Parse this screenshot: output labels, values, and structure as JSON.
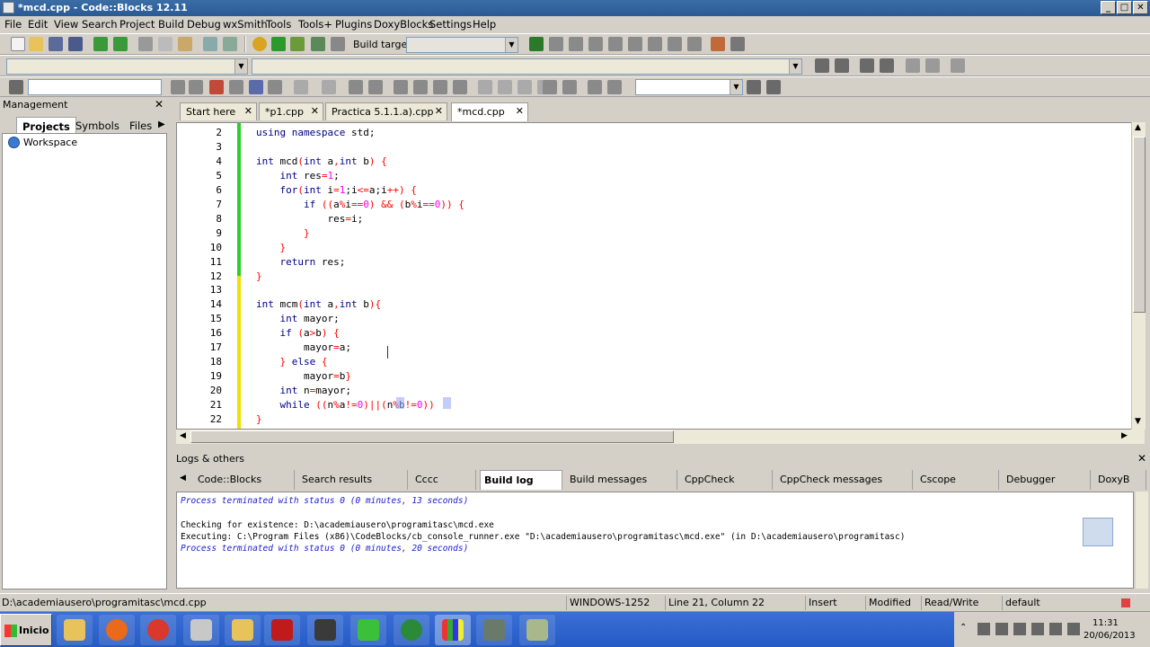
{
  "window": {
    "title": "*mcd.cpp - Code::Blocks 12.11",
    "min": "_",
    "max": "□",
    "close": "✕"
  },
  "menu": [
    "File",
    "Edit",
    "View",
    "Search",
    "Project",
    "Build",
    "Debug",
    "wxSmith",
    "Tools",
    "Tools+",
    "Plugins",
    "DoxyBlocks",
    "Settings",
    "Help"
  ],
  "toolbar": {
    "build_target_label": "Build target:",
    "build_target_value": ""
  },
  "management": {
    "title": "Management",
    "tabs": [
      "Projects",
      "Symbols",
      "Files"
    ],
    "active_tab": "Projects",
    "tree": [
      "Workspace"
    ]
  },
  "editor": {
    "tabs": [
      {
        "label": "Start here",
        "active": false
      },
      {
        "label": "*p1.cpp",
        "active": false
      },
      {
        "label": "Practica 5.1.1.a).cpp",
        "active": false
      },
      {
        "label": "*mcd.cpp",
        "active": true
      }
    ],
    "lines": [
      {
        "n": "2",
        "t": "using namespace std;"
      },
      {
        "n": "3",
        "t": ""
      },
      {
        "n": "4",
        "t": "int mcd(int a,int b) {"
      },
      {
        "n": "5",
        "t": "    int res=1;"
      },
      {
        "n": "6",
        "t": "    for(int i=1;i<=a;i++) {"
      },
      {
        "n": "7",
        "t": "        if ((a%i==0) && (b%i==0)) {"
      },
      {
        "n": "8",
        "t": "            res=i;"
      },
      {
        "n": "9",
        "t": "        }"
      },
      {
        "n": "10",
        "t": "    }"
      },
      {
        "n": "11",
        "t": "    return res;"
      },
      {
        "n": "12",
        "t": "}"
      },
      {
        "n": "13",
        "t": ""
      },
      {
        "n": "14",
        "t": "int mcm(int a,int b){"
      },
      {
        "n": "15",
        "t": "    int mayor;"
      },
      {
        "n": "16",
        "t": "    if (a>b) {"
      },
      {
        "n": "17",
        "t": "        mayor=a;"
      },
      {
        "n": "18",
        "t": "    } else {"
      },
      {
        "n": "19",
        "t": "        mayor=b}"
      },
      {
        "n": "20",
        "t": "    int n=mayor;"
      },
      {
        "n": "21",
        "t": "    while ((n%a!=0)||(n%b!=0))"
      },
      {
        "n": "22",
        "t": "}"
      }
    ]
  },
  "logs": {
    "title": "Logs & others",
    "tabs": [
      "Code::Blocks",
      "Search results",
      "Cccc",
      "Build log",
      "Build messages",
      "CppCheck",
      "CppCheck messages",
      "Cscope",
      "Debugger",
      "DoxyB"
    ],
    "active_tab": "Build log",
    "lines": [
      {
        "text": "Process terminated with status 0 (0 minutes, 13 seconds)",
        "style": "info"
      },
      {
        "text": "",
        "style": "plain"
      },
      {
        "text": "Checking for existence: D:\\academiausero\\programitasc\\mcd.exe",
        "style": "plain"
      },
      {
        "text": "Executing: C:\\Program Files (x86)\\CodeBlocks/cb_console_runner.exe \"D:\\academiausero\\programitasc\\mcd.exe\" (in D:\\academiausero\\programitasc)",
        "style": "plain"
      },
      {
        "text": "Process terminated with status 0 (0 minutes, 20 seconds)",
        "style": "info"
      }
    ]
  },
  "status": {
    "path": "D:\\academiausero\\programitasc\\mcd.cpp",
    "encoding": "WINDOWS-1252",
    "position": "Line 21, Column 22",
    "mode": "Insert",
    "modified": "Modified",
    "access": "Read/Write",
    "lang": "default"
  },
  "taskbar": {
    "start": "Inicio",
    "time": "11:31",
    "date": "20/06/2013"
  },
  "colors": {
    "keyword": "#00008b",
    "number": "#ff00ff",
    "operator": "#ff0000",
    "titlebar": "#2a5a95",
    "taskbar": "#245bc4"
  }
}
